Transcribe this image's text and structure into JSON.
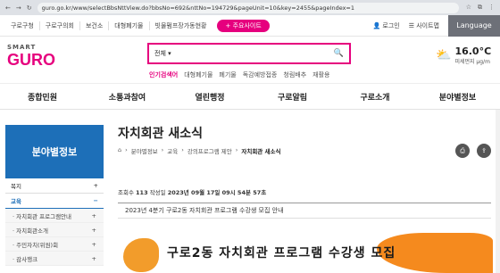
{
  "browser": {
    "url": "guro.go.kr/www/selectBbsNttView.do?bbsNo=692&nttNo=194729&pageUnit=10&key=2455&pageIndex=1"
  },
  "util": {
    "links": [
      "구로구청",
      "구로구의회",
      "보건소",
      "대형폐기물",
      "빗물펌프장가동현황"
    ],
    "sites_label": "주요사이트",
    "login": "로그인",
    "sitemap": "사이트맵",
    "language": "Language"
  },
  "header": {
    "logo_small": "SMART",
    "logo_big": "GURO",
    "search": {
      "select_value": "전체"
    },
    "keywords": {
      "title": "인기검색어",
      "items": [
        "대형폐기물",
        "폐기물",
        "독감예방접종",
        "청림배추",
        "재활용"
      ]
    },
    "weather": {
      "temp": "16.0°C",
      "dust": "미세먼지 µg/m"
    }
  },
  "gnb": [
    "종합민원",
    "소통과참여",
    "열린행정",
    "구로알림",
    "구로소개",
    "분야별정보"
  ],
  "side": {
    "title": "분야별정보",
    "items": [
      {
        "label": "복지",
        "toggle": "+"
      },
      {
        "label": "교육",
        "toggle": "−"
      }
    ],
    "subitems": [
      {
        "label": "자치회관 프로그램안내",
        "toggle": "+"
      },
      {
        "label": "자치회관소개",
        "toggle": "+"
      },
      {
        "label": "주민자치(위원)회",
        "toggle": "+"
      },
      {
        "label": "감사행크",
        "toggle": "+"
      }
    ]
  },
  "content": {
    "title": "자치회관 새소식",
    "breadcrumb": [
      "분야별정보",
      "교육",
      "강의프로그램 제안",
      "자치회관 새소식"
    ],
    "meta": {
      "views_label": "조회수",
      "views": "113",
      "date_label": "작성일",
      "date": "2023년 09월 17일 09시 54분 57초"
    },
    "post_title": "2023년 4분기 구로2동 자치회관 프로그램 수강생 모집 안내",
    "banner_title": "구로2동 자치회관 프로그램 수강생 모집"
  }
}
